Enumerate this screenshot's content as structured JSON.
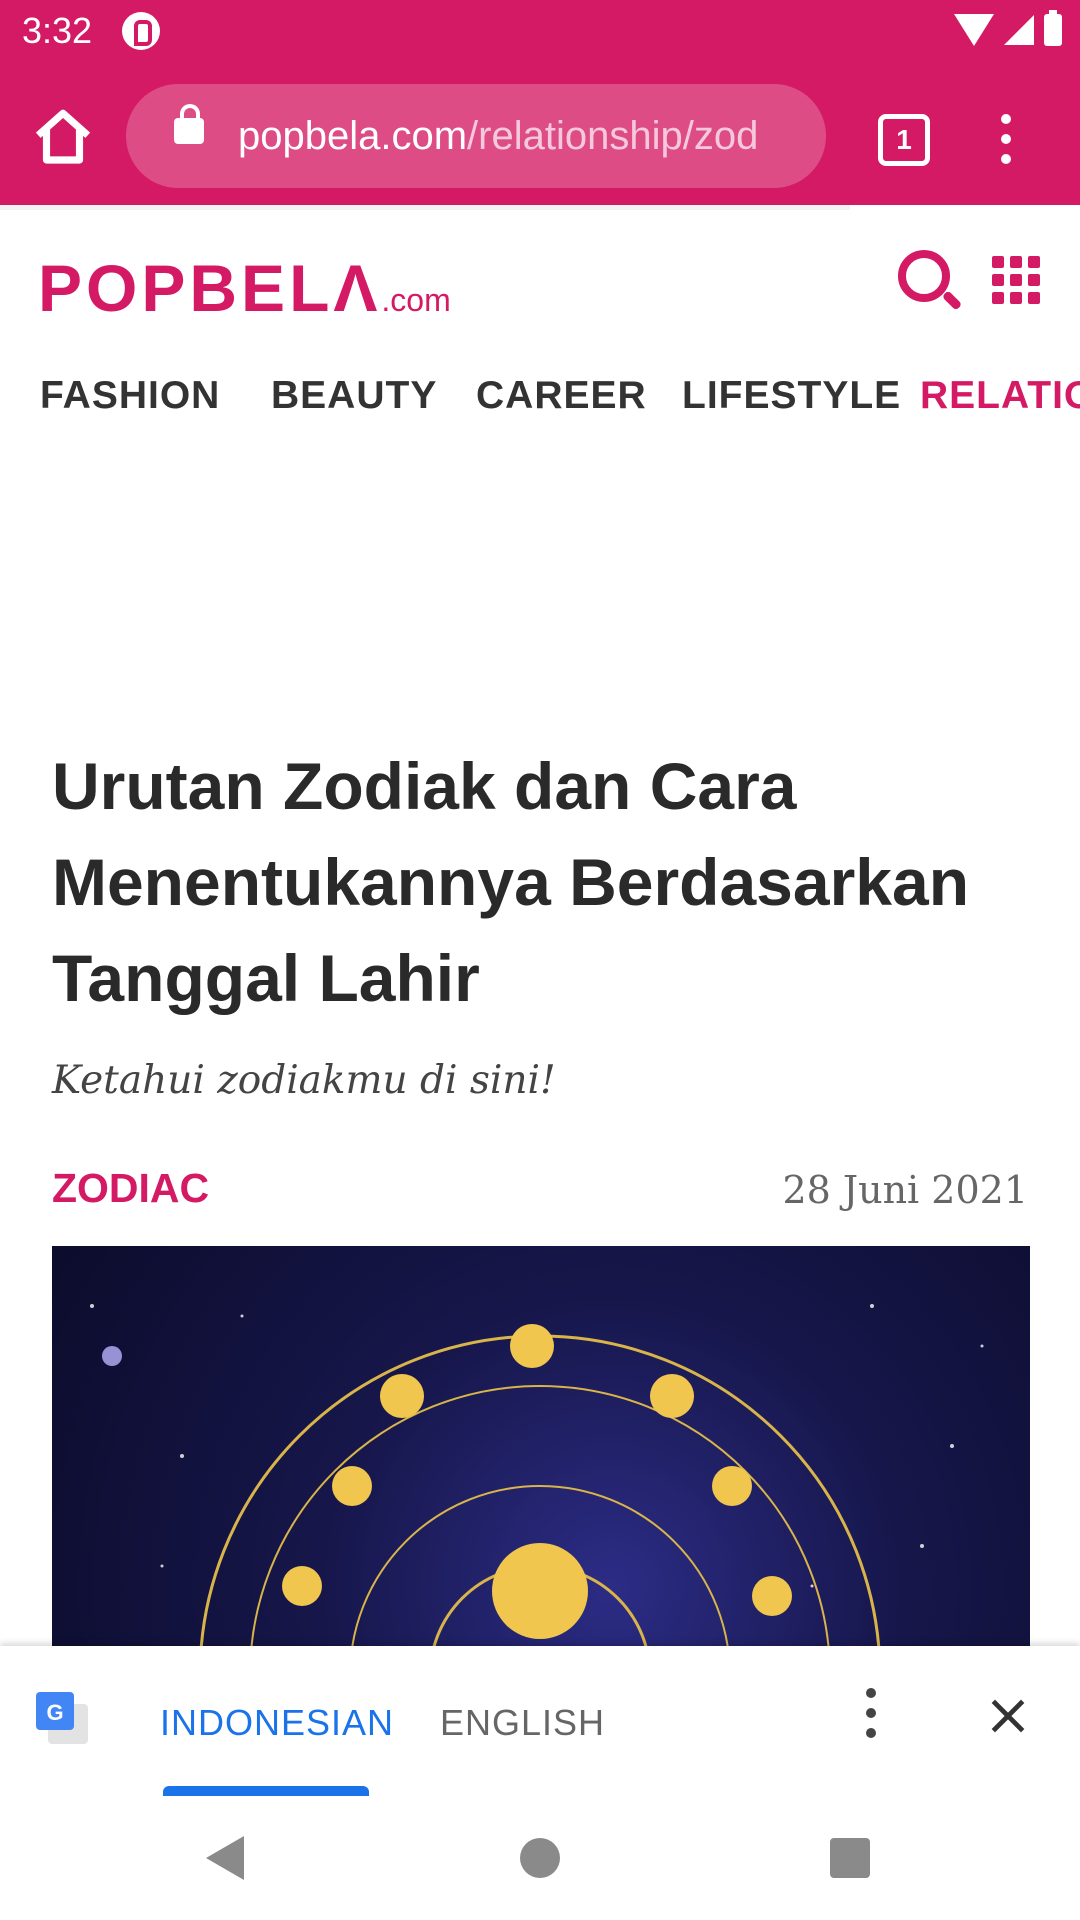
{
  "status_bar": {
    "time": "3:32"
  },
  "browser": {
    "url_domain": "popbela.com",
    "url_path": "/relationship/zod",
    "tab_count": "1"
  },
  "site": {
    "logo_main": "POPBELΛ",
    "logo_suffix": ".com",
    "brand_color": "#d51a65"
  },
  "nav": {
    "items": [
      {
        "label": "FASHION"
      },
      {
        "label": "BEAUTY"
      },
      {
        "label": "CAREER"
      },
      {
        "label": "LIFESTYLE"
      },
      {
        "label": "RELATIO"
      }
    ]
  },
  "article": {
    "title": "Urutan Zodiak dan Cara Menentukannya Berdasarkan Tanggal Lahir",
    "subtitle": "Ketahui zodiakmu di sini!",
    "category": "ZODIAC",
    "date": "28 Juni 2021"
  },
  "translate_bar": {
    "source_lang": "INDONESIAN",
    "target_lang": "ENGLISH"
  },
  "icons": {
    "home": "home-icon",
    "lock": "lock-icon",
    "search": "search-icon",
    "grid": "grid-menu-icon",
    "translate": "google-translate-icon",
    "close": "close-icon"
  }
}
